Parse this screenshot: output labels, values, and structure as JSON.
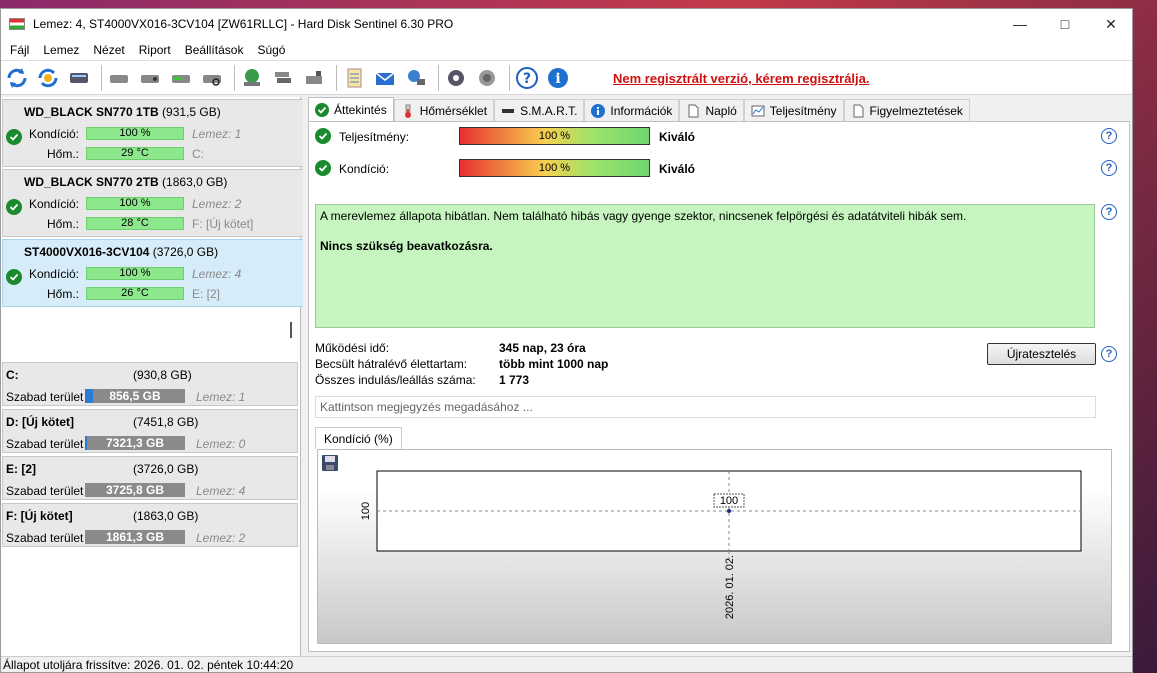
{
  "window": {
    "title": "Lemez: 4, ST4000VX016-3CV104 [ZW61RLLC]  -  Hard Disk Sentinel 6.30 PRO"
  },
  "menu": [
    "Fájl",
    "Lemez",
    "Nézet",
    "Riport",
    "Beállítások",
    "Súgó"
  ],
  "toolbar": {
    "unregistered": "Nem regisztrált verzió, kérem regisztrálja."
  },
  "disks": [
    {
      "name": "WD_BLACK SN770 1TB",
      "capacity": "(931,5 GB)",
      "cond_label": "Kondíció:",
      "cond_value": "100 %",
      "cond_fraction": 1.0,
      "temp_label": "Hőm.:",
      "temp_value": "29 °C",
      "disk_ref": "Lemez: 1",
      "drive": "C:"
    },
    {
      "name": "WD_BLACK SN770 2TB",
      "capacity": "(1863,0 GB)",
      "cond_label": "Kondíció:",
      "cond_value": "100 %",
      "cond_fraction": 1.0,
      "temp_label": "Hőm.:",
      "temp_value": "28 °C",
      "disk_ref": "Lemez: 2",
      "drive": "F: [Új kötet]"
    },
    {
      "name": "ST4000VX016-3CV104",
      "capacity": "(3726,0 GB)",
      "cond_label": "Kondíció:",
      "cond_value": "100 %",
      "cond_fraction": 1.0,
      "temp_label": "Hőm.:",
      "temp_value": "26 °C",
      "disk_ref": "Lemez: 4",
      "drive": "E: [2]"
    }
  ],
  "partitions": [
    {
      "name": "C:",
      "size": "(930,8 GB)",
      "free_label": "Szabad terület",
      "free": "856,5 GB",
      "used_fraction": 0.08,
      "disk_ref": "Lemez: 1"
    },
    {
      "name": "D: [Új kötet]",
      "size": "(7451,8 GB)",
      "free_label": "Szabad terület",
      "free": "7321,3 GB",
      "used_fraction": 0.02,
      "disk_ref": "Lemez: 0"
    },
    {
      "name": "E: [2]",
      "size": "(3726,0 GB)",
      "free_label": "Szabad terület",
      "free": "3725,8 GB",
      "used_fraction": 0.0,
      "disk_ref": "Lemez: 4"
    },
    {
      "name": "F: [Új kötet]",
      "size": "(1863,0 GB)",
      "free_label": "Szabad terület",
      "free": "1861,3 GB",
      "used_fraction": 0.0,
      "disk_ref": "Lemez: 2"
    }
  ],
  "tabs": [
    "Áttekintés",
    "Hőmérséklet",
    "S.M.A.R.T.",
    "Információk",
    "Napló",
    "Teljesítmény",
    "Figyelmeztetések"
  ],
  "overview": {
    "perf_label": "Teljesítmény:",
    "perf_value": "100 %",
    "perf_rating": "Kiváló",
    "cond_label": "Kondíció:",
    "cond_value": "100 %",
    "cond_rating": "Kiváló",
    "status_text": "A merevlemez állapota hibátlan. Nem található hibás vagy gyenge szektor, nincsenek felpörgési és adatátviteli hibák sem.",
    "status_action": "Nincs szükség beavatkozásra.",
    "uptime_label": "Működési idő:",
    "uptime": "345 nap, 23 óra",
    "life_label": "Becsült hátralévő élettartam:",
    "life": "több mint 1000 nap",
    "starts_label": "Összes indulás/leállás száma:",
    "starts": "1 773",
    "retest_button": "Újratesztelés",
    "note_placeholder": "Kattintson megjegyzés megadásához ...",
    "chart_tab": "Kondíció  (%)"
  },
  "chart_data": {
    "type": "line",
    "x": [
      "2026. 01. 02."
    ],
    "series": [
      {
        "values": [
          100
        ]
      }
    ],
    "ytick": "100",
    "point_label": "100"
  },
  "statusbar": "Állapot utoljára frissítve: 2026. 01. 02. péntek 10:44:20"
}
